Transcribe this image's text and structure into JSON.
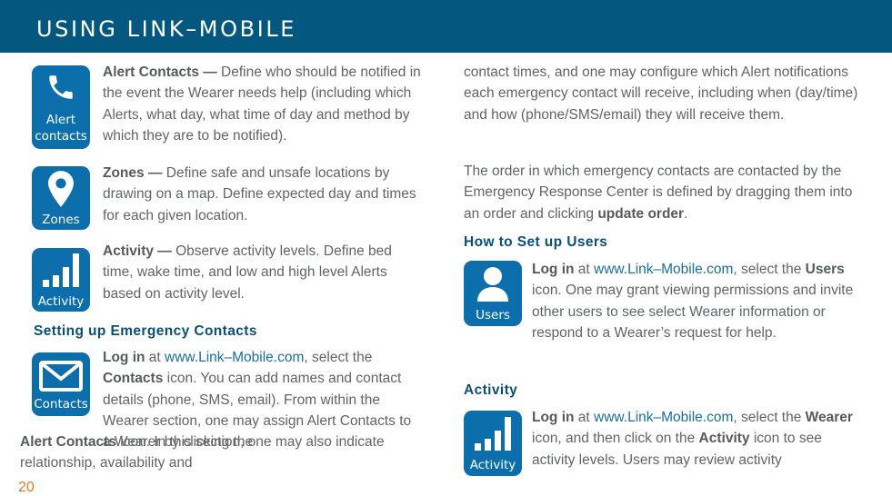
{
  "header": {
    "title": "USING LINK–MOBILE"
  },
  "colors": {
    "header_bg": "#04587f",
    "icon_bg": "#0c6fab",
    "heading": "#0a4f78",
    "link": "#1a6e9c",
    "page_number": "#e07a2a",
    "body_text": "#5f6567"
  },
  "left_column": {
    "features": [
      {
        "icon": "phone-icon",
        "icon_label_1": "Alert",
        "icon_label_2": "contacts",
        "title": "Alert Contacts —",
        "text": " Define who should be notified in the event the Wearer needs help (including which Alerts, what day, what time of day and method by which they are to be notified)."
      },
      {
        "icon": "map-pin-icon",
        "icon_label": "Zones",
        "title": "Zones —",
        "text": " Define safe and unsafe locations by drawing on a map. Define expected day and times for each given location."
      },
      {
        "icon": "activity-bars-icon",
        "icon_label": "Activity",
        "title": "Activity —",
        "text": " Observe activity levels. Define bed time, wake time, and low and high level Alerts based on activity level."
      }
    ],
    "emergency": {
      "heading": "Setting up Emergency Contacts",
      "icon": "envelope-icon",
      "icon_label": "Contacts",
      "login": "Log in",
      "at": " at ",
      "link": "www.Link–Mobile.com",
      "t1": ", select the ",
      "contacts_bold": "Contacts",
      "t2": " icon. You can add names and contact details (phone, SMS, email). From within the Wearer section, one may assign Alert Contacts to a Wearer by clicking the ",
      "alert_contacts_bold": "Alert Contacts",
      "t3": " icon. In this section, one may also indicate relationship, availability and"
    }
  },
  "right_column": {
    "continued": "contact times, and one may configure which Alert notifications each emergency contact will receive, including when (day/time) and how (phone/SMS/email) they will receive them.",
    "order_text": "The order in which emergency contacts are contacted by the Emergency Response Center is defined by dragging them into an order and clicking ",
    "order_bold": "update order",
    "order_end": ".",
    "users": {
      "heading": "How to Set up Users",
      "icon": "user-icon",
      "icon_label": "Users",
      "login": "Log in",
      "at": " at ",
      "link": "www.Link–Mobile.com",
      "t1": ", select the ",
      "users_bold": "Users",
      "t2": " icon. One may grant viewing permissions and invite other users to see select Wearer information or respond to a Wearer’s request for help."
    },
    "activity": {
      "heading": "Activity",
      "icon": "activity-bars-icon",
      "icon_label": "Activity",
      "login": "Log in",
      "at": " at ",
      "link": "www.Link–Mobile.com",
      "t1": ", select the ",
      "wearer_bold": "Wearer",
      "t2": " icon, and then click on the ",
      "activity_bold": "Activity",
      "t3": " icon to see activity levels. Users may review activity"
    }
  },
  "footer": {
    "page_number": "20"
  }
}
